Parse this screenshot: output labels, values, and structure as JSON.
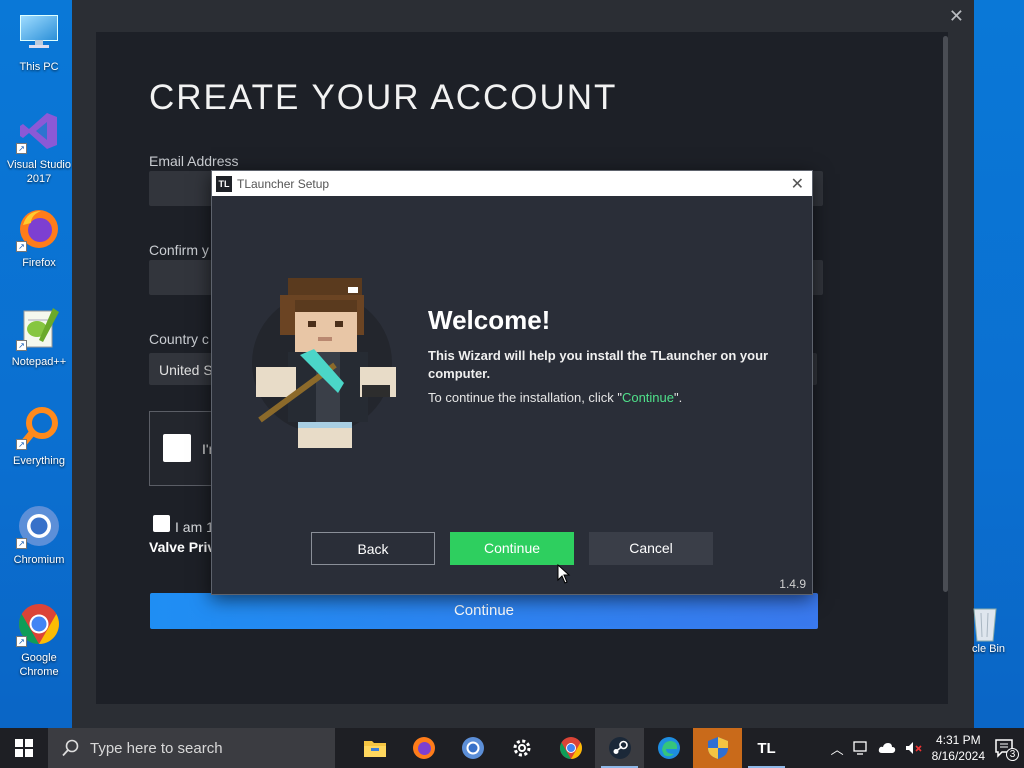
{
  "desktop": {
    "icons": [
      {
        "label": "This PC",
        "icon": "this-pc-icon"
      },
      {
        "label": "Visual Studio 2017",
        "icon": "visual-studio-icon"
      },
      {
        "label": "Firefox",
        "icon": "firefox-icon"
      },
      {
        "label": "Notepad++",
        "icon": "notepad-plus-plus-icon"
      },
      {
        "label": "Everything",
        "icon": "everything-search-icon"
      },
      {
        "label": "Chromium",
        "icon": "chromium-icon"
      },
      {
        "label": "Google Chrome",
        "icon": "google-chrome-icon"
      }
    ],
    "recycle_bin": "cle Bin"
  },
  "steam": {
    "title": "CREATE YOUR ACCOUNT",
    "email_label": "Email Address",
    "confirm_label": "Confirm y",
    "country_label": "Country c",
    "country_value": "United S",
    "captcha_text": "I'r",
    "age_text": "I am 1",
    "valve_text": "Valve Priv",
    "continue_label": "Continue"
  },
  "dialog": {
    "badge": "TL",
    "title": "TLauncher Setup",
    "welcome": "Welcome!",
    "line1": "This Wizard will help you install the TLauncher on your computer.",
    "line2_pre": "To continue the installation, click \"",
    "line2_hl": "Continue",
    "line2_post": "\".",
    "back_label": "Back",
    "continue_label": "Continue",
    "cancel_label": "Cancel",
    "version": "1.4.9"
  },
  "taskbar": {
    "search_placeholder": "Type here to search",
    "apps": [
      "file-explorer-icon",
      "firefox-icon",
      "chromium-icon",
      "settings-icon",
      "chrome-icon",
      "steam-icon",
      "edge-icon",
      "setup-shield-icon",
      "tlauncher-icon"
    ],
    "tlauncher_label": "TL",
    "time": "4:31 PM",
    "date": "8/16/2024",
    "notifications": "3"
  },
  "colors": {
    "accent_green": "#2ecf5f",
    "steam_blue": "#1f8ef3",
    "desktop_blue": "#0a78d7"
  }
}
